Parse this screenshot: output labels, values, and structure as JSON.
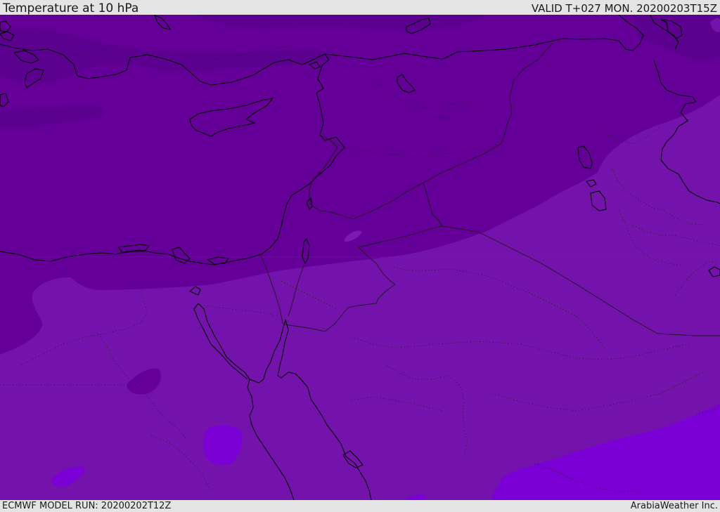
{
  "header": {
    "title": "Temperature at 10 hPa",
    "valid": "VALID T+027 MON. 20200203T15Z"
  },
  "footer": {
    "model_run": "ECMWF MODEL RUN: 20200202T12Z",
    "credit": "ArabiaWeather Inc."
  },
  "colors": {
    "band_darkest": "#5c0090",
    "band_dark": "#640097",
    "band_mid": "#7413ab",
    "band_light": "#7a00d6",
    "coastline": "#000000",
    "border": "#1a1a1a"
  }
}
